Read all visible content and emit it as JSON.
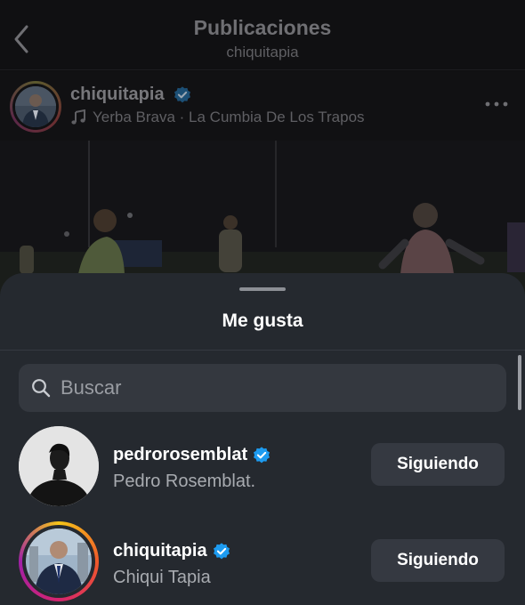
{
  "topbar": {
    "title": "Publicaciones",
    "subtitle": "chiquitapia"
  },
  "post": {
    "username": "chiquitapia",
    "verified": true,
    "music": "Yerba Brava · La Cumbia De Los Trapos"
  },
  "likes_sheet": {
    "title": "Me gusta",
    "search_placeholder": "Buscar",
    "users": [
      {
        "username": "pedrorosemblat",
        "full_name": "Pedro Rosemblat.",
        "verified": true,
        "button_label": "Siguiendo"
      },
      {
        "username": "chiquitapia",
        "full_name": "Chiqui Tapia",
        "verified": true,
        "button_label": "Siguiendo"
      }
    ]
  },
  "colors": {
    "sheet_background": "#25292f",
    "verified_badge": "#1d9bf0",
    "button_background": "#353941"
  },
  "icons": [
    "back-icon",
    "verified-icon",
    "music-note-icon",
    "more-icon",
    "search-icon"
  ]
}
